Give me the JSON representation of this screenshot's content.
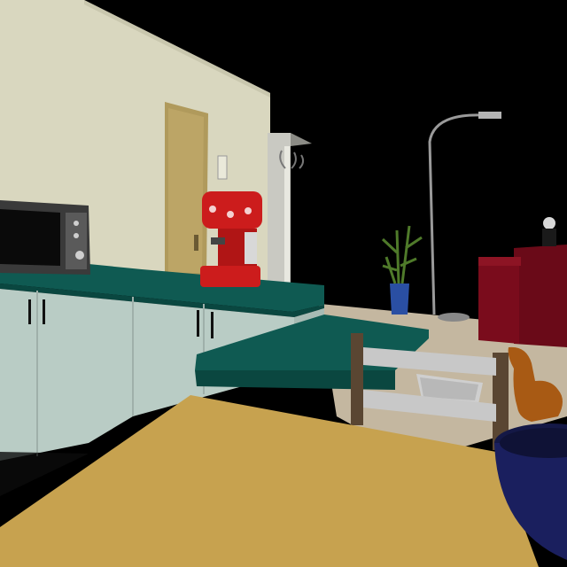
{
  "scene": {
    "kind": "3d-rendered-kitchen-living-room",
    "objects": [
      "back-wall",
      "interior-door",
      "light-switch",
      "microwave",
      "espresso-machine",
      "kitchen-counter",
      "lower-cabinets",
      "cabinet-handles",
      "kitchen-island",
      "bar-stool-chair",
      "dining-table",
      "blue-bowl",
      "brown-dog-figure",
      "potted-plant",
      "floor-lamp",
      "red-sofa",
      "shaggy-rug",
      "coat-rack"
    ],
    "colors": {
      "background": "#000000",
      "wall": "#d9d7bf",
      "door": "#b09a5c",
      "counter_top": "#0f5a52",
      "cabinet": "#b9ccc5",
      "table": "#c7a24f",
      "espresso_machine": "#cc1c1c",
      "microwave_body": "#3a3a3a",
      "sofa": "#7a0c1c",
      "bowl": "#1a1f5e",
      "floor": "#c4b7a0"
    }
  }
}
